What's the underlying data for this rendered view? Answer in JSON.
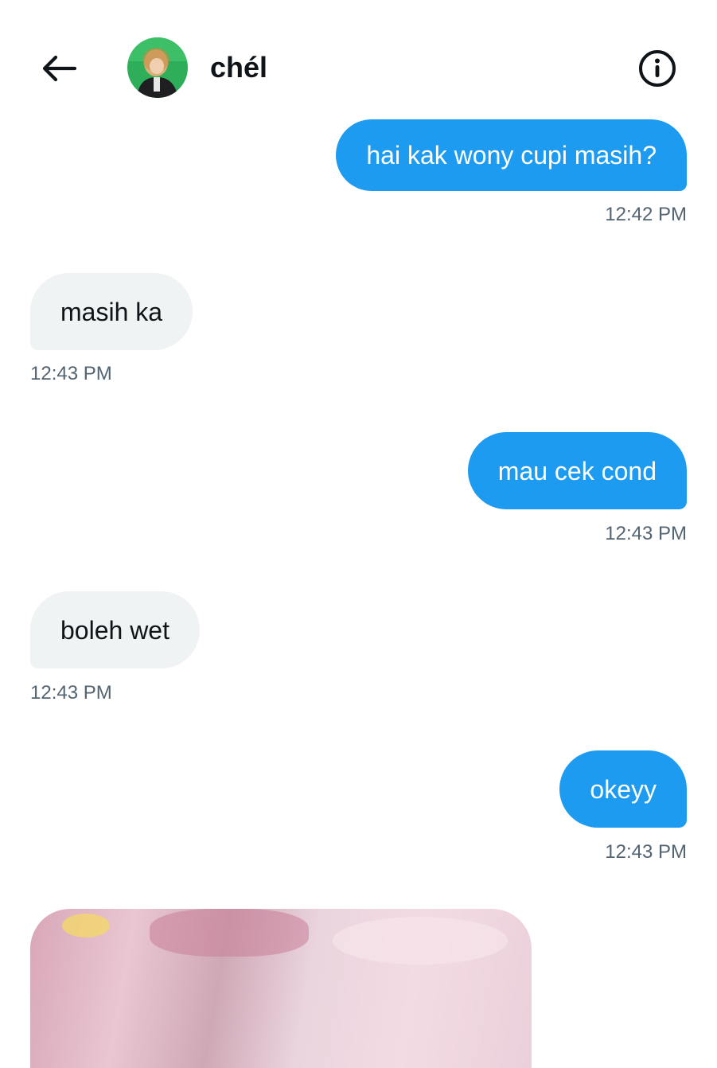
{
  "header": {
    "contact_name": "chél",
    "back_icon": "arrow-left-icon",
    "info_icon": "info-circle-icon"
  },
  "messages": [
    {
      "direction": "outgoing",
      "text": "hai kak wony cupi masih?",
      "time": "12:42 PM"
    },
    {
      "direction": "incoming",
      "text": "masih ka",
      "time": "12:43 PM"
    },
    {
      "direction": "outgoing",
      "text": "mau cek cond",
      "time": "12:43 PM"
    },
    {
      "direction": "incoming",
      "text": "boleh wet",
      "time": "12:43 PM"
    },
    {
      "direction": "outgoing",
      "text": "okeyy",
      "time": "12:43 PM"
    }
  ],
  "colors": {
    "outgoing_bubble": "#1d9bf0",
    "incoming_bubble": "#eff3f4",
    "timestamp": "#536471",
    "text_dark": "#0f1419"
  }
}
